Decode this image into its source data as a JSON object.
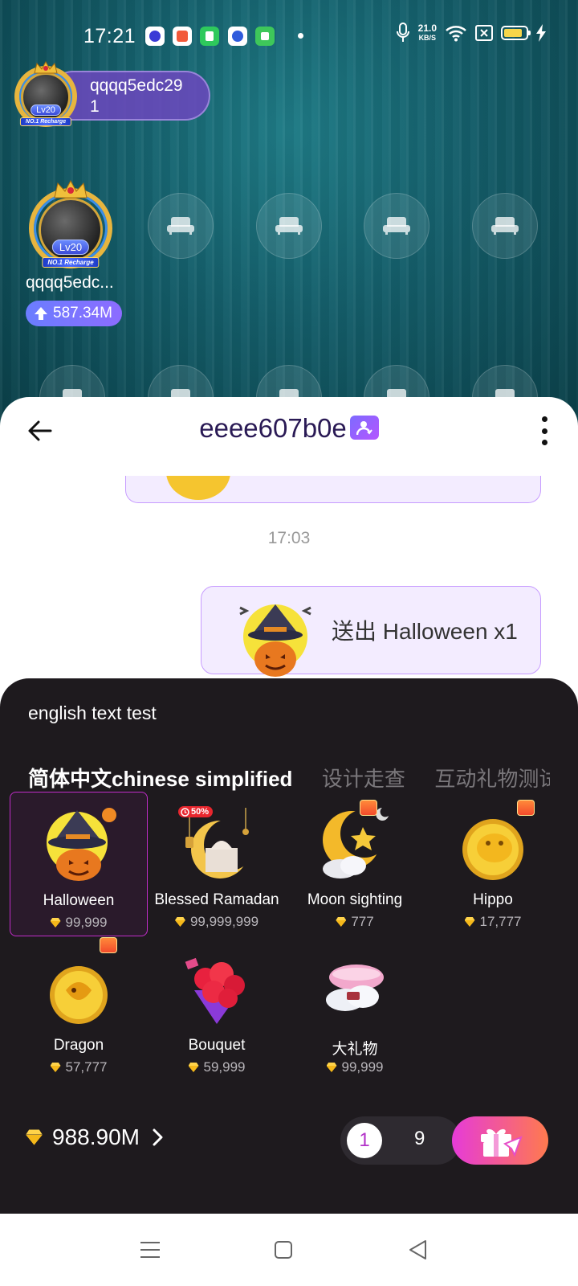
{
  "status_bar": {
    "time": "17:21",
    "net_speed_value": "21.0",
    "net_speed_unit": "KB/S",
    "battery_level": 0.85
  },
  "host": {
    "name_line1": "qqqq5edc29",
    "name_line2": "1",
    "level": "Lv20",
    "badge": "NO.1 Recharge"
  },
  "seat_user": {
    "name": "qqqq5edc...",
    "score": "587.34M",
    "level": "Lv20",
    "badge": "NO.1 Recharge"
  },
  "chat": {
    "title": "eeee607b0e",
    "time": "17:03",
    "gift_message": "送出 Halloween x1"
  },
  "gift_panel": {
    "caption": "english text test",
    "tabs": [
      {
        "label": "简体中文chinese simplified"
      },
      {
        "label": "设计走查"
      },
      {
        "label": "互动礼物测试"
      }
    ],
    "gifts": [
      {
        "name": "Halloween",
        "price": "99,999"
      },
      {
        "name": "Blessed Ramadan",
        "price": "99,999,999",
        "tag": "50%"
      },
      {
        "name": "Moon sighting",
        "price": "777"
      },
      {
        "name": "Hippo",
        "price": "17,777"
      },
      {
        "name": "Dragon",
        "price": "57,777"
      },
      {
        "name": "Bouquet",
        "price": "59,999"
      },
      {
        "name": "大礼物",
        "price": "99,999"
      }
    ],
    "balance": "988.90M",
    "quantity_selected": "1",
    "quantity_other": "9"
  },
  "colors": {
    "accent": "#c12cc9",
    "send_gradient_start": "#e63bd8",
    "send_gradient_end": "#ff7a4e",
    "panel_bg": "#1e1a1e"
  }
}
